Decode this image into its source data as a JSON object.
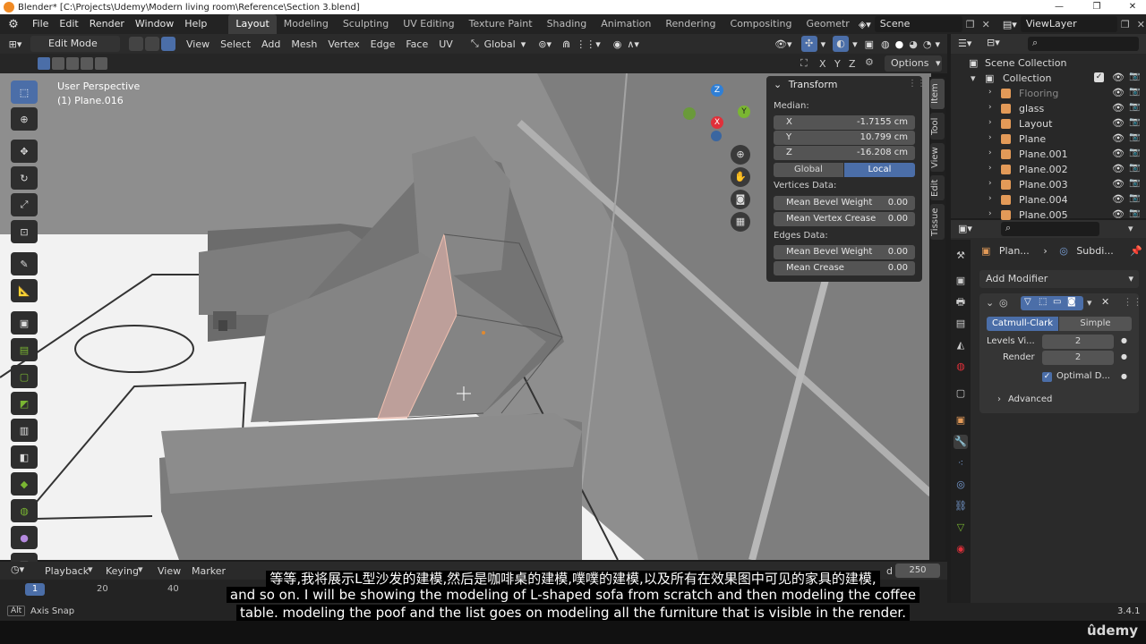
{
  "window": {
    "title": "Blender* [C:\\Projects\\Udemy\\Modern living room\\Reference\\Section 3.blend]",
    "minimize": "—",
    "maximize": "❐",
    "close": "✕"
  },
  "topbar": {
    "menus": [
      "File",
      "Edit",
      "Render",
      "Window",
      "Help"
    ],
    "workspaces": [
      "Layout",
      "Modeling",
      "Sculpting",
      "UV Editing",
      "Texture Paint",
      "Shading",
      "Animation",
      "Rendering",
      "Compositing",
      "Geometr"
    ],
    "active_workspace": "Layout",
    "scene_label": "Scene",
    "view_layer_label": "ViewLayer"
  },
  "viewport_header": {
    "mode": "Edit Mode",
    "menus": [
      "View",
      "Select",
      "Add",
      "Mesh",
      "Vertex",
      "Edge",
      "Face",
      "UV"
    ],
    "orientation": "Global",
    "axes": [
      "X",
      "Y",
      "Z"
    ],
    "options_label": "Options"
  },
  "viewport": {
    "perspective_label": "User Perspective",
    "object_label": "(1) Plane.016"
  },
  "gizmo": {
    "z": "Z",
    "y": "Y",
    "x": "X"
  },
  "n_panel": {
    "title": "Transform",
    "median_label": "Median:",
    "x_label": "X",
    "x_value": "-1.7155 cm",
    "y_label": "Y",
    "y_value": "10.799 cm",
    "z_label": "Z",
    "z_value": "-16.208 cm",
    "global_btn": "Global",
    "local_btn": "Local",
    "vertices_label": "Vertices Data:",
    "mean_bevel_weight_label": "Mean Bevel Weight",
    "mean_bevel_weight_value": "0.00",
    "mean_vertex_crease_label": "Mean Vertex Crease",
    "mean_vertex_crease_value": "0.00",
    "edges_label": "Edges Data:",
    "edge_bevel_weight_label": "Mean Bevel Weight",
    "edge_bevel_weight_value": "0.00",
    "mean_crease_label": "Mean Crease",
    "mean_crease_value": "0.00"
  },
  "side_tabs": [
    "Item",
    "Tool",
    "View",
    "Edit",
    "Tissue"
  ],
  "outliner": {
    "scene_collection": "Scene Collection",
    "collection": "Collection",
    "items": [
      {
        "name": "Flooring",
        "dim": true
      },
      {
        "name": "glass",
        "dim": false
      },
      {
        "name": "Layout",
        "dim": false
      },
      {
        "name": "Plane",
        "dim": false
      },
      {
        "name": "Plane.001",
        "dim": false
      },
      {
        "name": "Plane.002",
        "dim": false
      },
      {
        "name": "Plane.003",
        "dim": false
      },
      {
        "name": "Plane.004",
        "dim": false
      },
      {
        "name": "Plane.005",
        "dim": false
      }
    ]
  },
  "properties": {
    "breadcrumb_object": "Plan...",
    "breadcrumb_modifier": "Subdi...",
    "add_modifier": "Add Modifier",
    "catmull_clark": "Catmull-Clark",
    "simple": "Simple",
    "levels_label": "Levels Vi...",
    "levels_value": "2",
    "render_label": "Render",
    "render_value": "2",
    "optimal_label": "Optimal D...",
    "advanced_label": "Advanced"
  },
  "timeline": {
    "menus": [
      "Playback",
      "Keying",
      "View",
      "Marker"
    ],
    "current_frame": "1",
    "ticks": [
      "20",
      "40"
    ],
    "end_frame": "250",
    "end_partial": "d"
  },
  "statusbar": {
    "key": "Alt",
    "hint": "Axis Snap",
    "version": "3.4.1"
  },
  "subtitles": {
    "chinese": "等等,我将展示L型沙发的建模,然后是咖啡桌的建模,噗噗的建模,以及所有在效果图中可见的家具的建模,",
    "line1": "and so on. I will be showing the modeling of L-shaped sofa from scratch and then modeling the coffee",
    "line2": "table. modeling the poof and the list goes on modeling all the furniture that is visible in the render."
  },
  "watermark": "ûdemy",
  "colors": {
    "accent_blue": "#4b6ea8",
    "axis_x": "#e0303a",
    "axis_y": "#7ab632",
    "axis_z": "#2f7fd6",
    "face_select": "#e3b1a8"
  }
}
